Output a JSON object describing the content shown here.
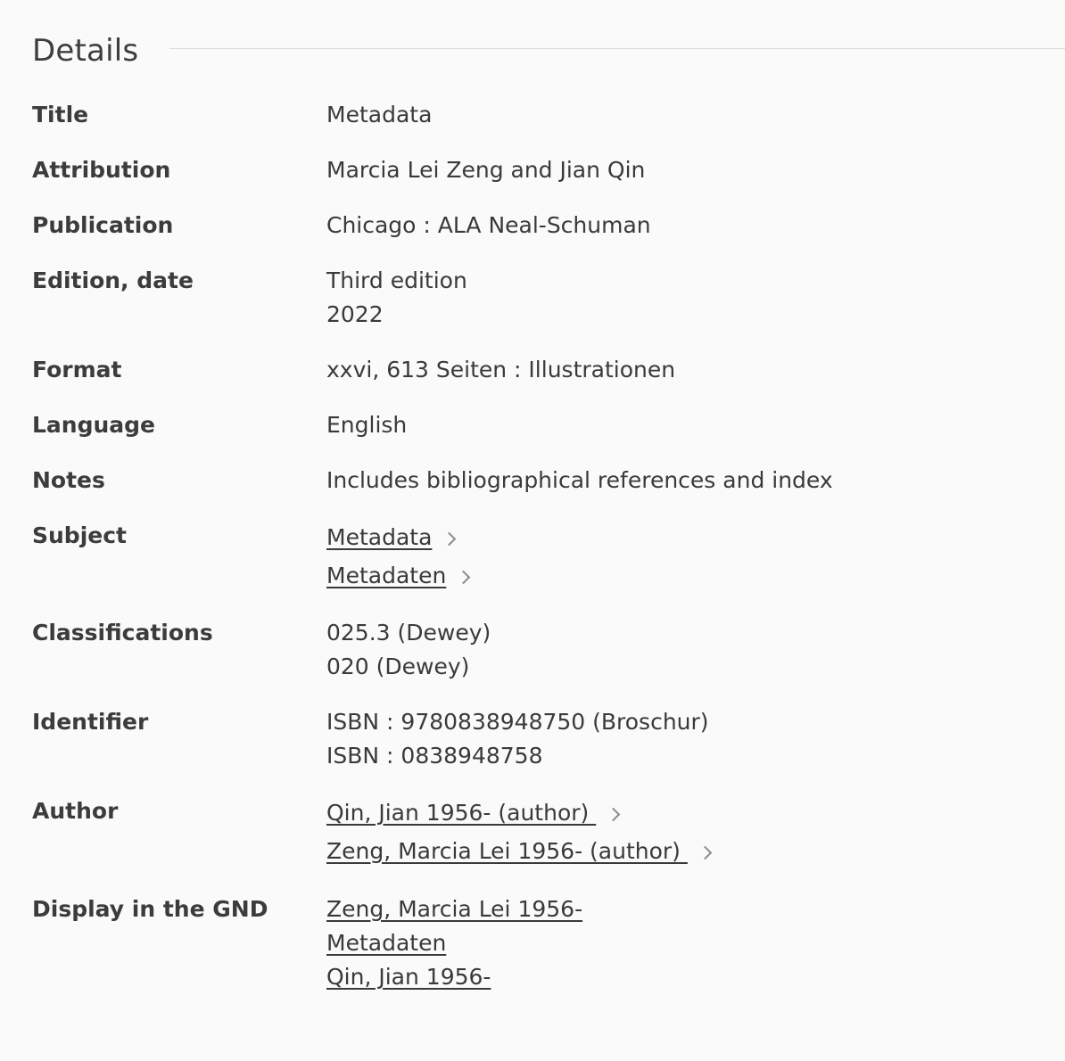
{
  "section": {
    "title": "Details"
  },
  "rows": {
    "title": {
      "label": "Title",
      "value": "Metadata"
    },
    "attribution": {
      "label": "Attribution",
      "value": "Marcia Lei Zeng and Jian Qin"
    },
    "publication": {
      "label": "Publication",
      "value": "Chicago : ALA Neal-Schuman"
    },
    "edition": {
      "label": "Edition, date",
      "values": [
        "Third edition",
        "2022"
      ]
    },
    "format": {
      "label": "Format",
      "value": "xxvi, 613 Seiten : Illustrationen"
    },
    "language": {
      "label": "Language",
      "value": "English"
    },
    "notes": {
      "label": "Notes",
      "value": "Includes bibliographical references and index"
    },
    "subject": {
      "label": "Subject",
      "links": [
        "Metadata",
        "Metadaten"
      ]
    },
    "classifications": {
      "label": "Classifications",
      "values": [
        "025.3 (Dewey)",
        "020 (Dewey)"
      ]
    },
    "identifier": {
      "label": "Identifier",
      "values": [
        "ISBN : 9780838948750 (Broschur)",
        "ISBN : 0838948758"
      ]
    },
    "author": {
      "label": "Author",
      "links": [
        "Qin, Jian 1956- (author) ",
        "Zeng, Marcia Lei 1956- (author) "
      ]
    },
    "gnd": {
      "label": "Display in the GND",
      "links": [
        "Zeng, Marcia Lei 1956-",
        "Metadaten",
        "Qin, Jian 1956-"
      ]
    }
  },
  "icons": {
    "link_arrow": "chevron-right-icon"
  },
  "colors": {
    "background": "#fafafa",
    "text": "#3a3a3a",
    "chevron": "#8a8a8a",
    "rule": "#dcdcdc"
  }
}
